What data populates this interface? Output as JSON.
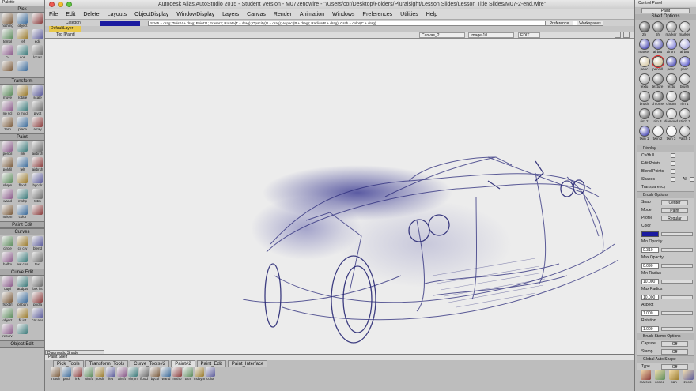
{
  "window": {
    "title": "Autodesk Alias AutoStudio 2015  -  Student Version  -  M072endwire - \"/Users/cor/Desktop/Folders/Pluralsight/Lesson Slides/Lesson Title Slides/M07-2-end.wire\""
  },
  "menu": [
    "File",
    "Edit",
    "Delete",
    "Layouts",
    "ObjectDisplay",
    "WindowDisplay",
    "Layers",
    "Canvas",
    "Render",
    "Animation",
    "Windows",
    "Preferences",
    "Utilities",
    "Help"
  ],
  "toolbar": {
    "category": "Category",
    "command": "Size5 + drag; TwistV + drag; Point11; Eraser2; Rotate(T + drag); Opacity(O + drag); Aspect(P + drag); Radius(R + drag); Grab + color(C + drag)",
    "pref": "Preference Sets",
    "workspaces": "Workspaces"
  },
  "layer": {
    "default": "DefaultLayer"
  },
  "view": {
    "name": "Top [Paint]",
    "canvas": "Canvas_2",
    "image": "Image-10",
    "mode": "EDIT"
  },
  "palette": {
    "title": "Palette",
    "sections": [
      {
        "title": "Pick",
        "tools": [
          "nothing",
          "object",
          "",
          "templ",
          "ref",
          "edit",
          "cv",
          "cos",
          "locatr",
          "",
          ""
        ]
      },
      {
        "title": "Transform",
        "tools": [
          "move",
          "rotate",
          "scale",
          "np scl",
          "p mod",
          "pivot",
          "zero",
          "place",
          "array"
        ]
      },
      {
        "title": "Paint",
        "tools": [
          "pencil",
          "ink",
          "airbrsh",
          "polyfil",
          "felt",
          "airbrsh",
          "shrpn",
          "flood",
          "bycolr",
          "wand",
          "mshp",
          "txtm",
          "mdsym",
          "color",
          ""
        ]
      },
      {
        "title": "Paint Edit",
        "tools": []
      },
      {
        "title": "Curves",
        "tools": [
          "circle",
          "cv crv",
          "blend",
          "halfm",
          "ew cos",
          "text"
        ]
      },
      {
        "title": "Curve Edit",
        "tools": [
          "dupl",
          "addpts",
          "brk int",
          "fsbctrl",
          "prjban",
          "prjcta",
          "object",
          "fit int",
          "crv.ans",
          "recurv",
          ""
        ]
      }
    ],
    "objedit": "Object Edit"
  },
  "control": {
    "title": "Control Panel",
    "mode": "Paint",
    "shelf": "Shelf Options",
    "brushes": [
      "2h",
      "6h",
      "marker",
      "marker",
      "marker",
      "airbru",
      "airbru",
      "airbru",
      "penc",
      "pencill",
      "penc",
      "penc",
      "textu",
      "texture",
      "textu",
      "brush",
      "brush",
      "chrome",
      "chrom",
      "rim 1",
      "rim 2",
      "rim 3",
      "diamond",
      "stitch 1",
      "twin 1",
      "twin 2",
      "twin 3",
      "Patch 1"
    ],
    "display": {
      "title": "Display",
      "rows": [
        "Cv/Hull",
        "Edit Points",
        "Blend Points",
        "Shapes"
      ],
      "all": "All",
      "transparency": "Transparency"
    },
    "brush": {
      "title": "Brush Options",
      "snap": "Snap",
      "snap_v": "Center",
      "mode": "Mode",
      "mode_v": "Paint",
      "profile": "Profile",
      "profile_v": "Regular",
      "color": "Color",
      "min_opacity": "Min Opacity",
      "min_opacity_v": "0.310",
      "max_opacity": "Max Opacity",
      "max_opacity_v": "0.090",
      "min_radius": "Min Radius",
      "min_radius_v": "10.000",
      "max_radius": "Max Radius",
      "max_radius_v": "10.000",
      "aspect": "Aspect",
      "aspect_v": "1.000",
      "rotation": "Rotation",
      "rotation_v": "1.000"
    },
    "stamp": {
      "title": "Brush Stamp Options",
      "capture": "Capture",
      "capture_v": "Off",
      "stamp": "Stamp",
      "stamp_v": "Off"
    },
    "global": {
      "title": "Global Auto Shape",
      "type": "Type",
      "type_v": "Off"
    },
    "bottom": [
      "marcus",
      "cosed",
      "pan",
      "zoom"
    ]
  },
  "bottomshelf": {
    "diag": "Diagnostic Shade",
    "title": "Paint Shelf",
    "tabs": [
      "Pick_Tools",
      "Transform_Tools",
      "Curve_Tools#2",
      "Paint#2",
      "Paint_Edit",
      "Paint_Interface"
    ],
    "active": "Paint#2",
    "tools": [
      "Trash",
      "pncl",
      "ink",
      "airsft",
      "polsft",
      "felt",
      "airsft",
      "shrpn",
      "flood",
      "bycol",
      "wand",
      "mshp",
      "txtm",
      "mdsym",
      "color"
    ]
  },
  "colors": {
    "accent": "#1a1aa0",
    "sketch": "#1e1e6e",
    "canvas": "#ececec",
    "panel": "#bdbdbd"
  }
}
